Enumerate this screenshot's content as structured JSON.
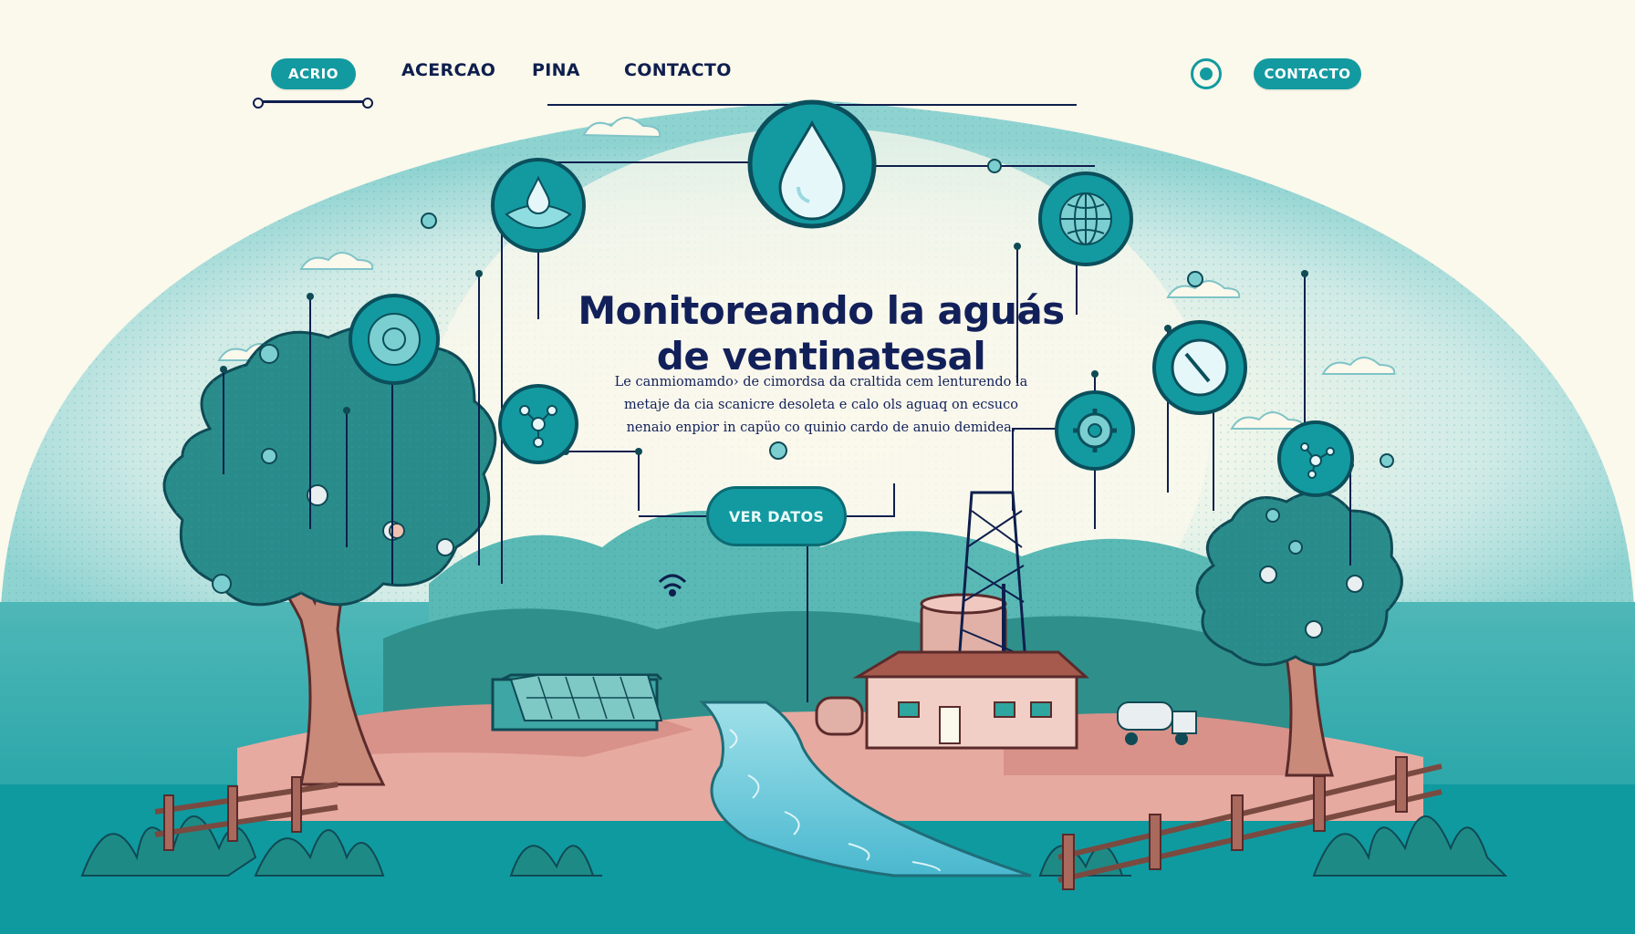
{
  "nav": {
    "home_label": "ACRIO",
    "links": [
      {
        "label": "ACERCAO"
      },
      {
        "label": "PINA"
      },
      {
        "label": "CONTACTO"
      }
    ],
    "contact_button_label": "CONTACTO"
  },
  "hero": {
    "title_line1": "Monitoreando la aguás",
    "title_line2": "de ventinatesal",
    "subtitle_line1": "Le canmiomamdo› de cimordsa da craltida cem lenturendo la",
    "subtitle_line2": "metaje da cia scanicre desoleta e calo ols aguaq on ecsuco",
    "subtitle_line3": "nenaio enpior in capüo co quinio cardo de anuio demidea.",
    "cta_label": "VER DATOS"
  },
  "colors": {
    "teal": "#139aa0",
    "dark_teal": "#0b6b74",
    "navy": "#12205a",
    "cream": "#fbf8ec",
    "soil": "#d99c92",
    "water": "#5cc6d8"
  },
  "icons": [
    "water-drop-icon",
    "leaf-drop-icon",
    "globe-icon",
    "sensor-icon",
    "molecule-icon",
    "gauge-icon",
    "gear-icon",
    "network-icon",
    "wifi-icon"
  ]
}
